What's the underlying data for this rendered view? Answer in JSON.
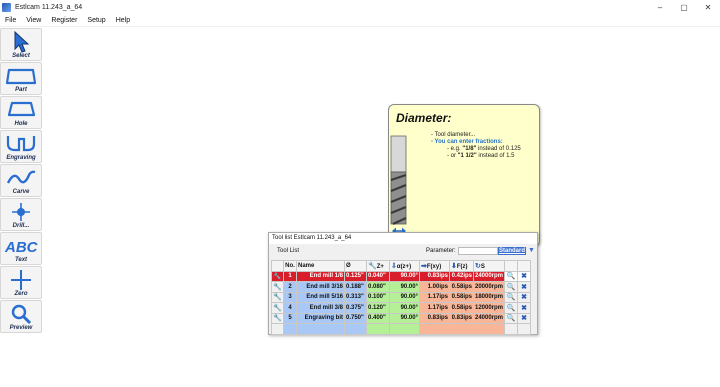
{
  "window": {
    "title": "Estlcam 11.243_a_64",
    "minimize_glyph": "–",
    "maximize_glyph": "▢",
    "close_glyph": "✕"
  },
  "menu": [
    "File",
    "View",
    "Register",
    "Setup",
    "Help"
  ],
  "toolbar": [
    {
      "label": "Select",
      "icon": "cursor-arrow-icon"
    },
    {
      "label": "Part",
      "icon": "part-outline-icon"
    },
    {
      "label": "Hole",
      "icon": "hole-outline-icon"
    },
    {
      "label": "Engraving",
      "icon": "engraving-path-icon"
    },
    {
      "label": "Carve",
      "icon": "carve-wave-icon"
    },
    {
      "label": "Drill...",
      "icon": "drill-target-icon"
    },
    {
      "label": "Text",
      "icon": "text-abc-icon"
    },
    {
      "label": "Zero",
      "icon": "zero-cross-icon"
    },
    {
      "label": "Preview",
      "icon": "magnifier-icon"
    }
  ],
  "tooltip": {
    "title": "Diameter:",
    "line1": "- Tool diameter...",
    "line2": "- You can enter fractions:",
    "line3_prefix": "- e.g. ",
    "line3_bold": "\"1/8\"",
    "line3_suffix": " instead of 0.125",
    "line4_prefix": "- or ",
    "line4_bold": "\"1 1/2\"",
    "line4_suffix": " instead of 1.5"
  },
  "toollist": {
    "window_title": "Tool list Estlcam 11.243_a_64",
    "section_label": "Tool List",
    "parameter_label": "Parameter:",
    "parameter_value": "Standard",
    "columns": [
      "No.",
      "Name",
      "Ø",
      "Z+",
      "α(z+)",
      "F(xy)",
      "F(z)",
      "S"
    ],
    "rows": [
      {
        "no": "1",
        "name": "End mill 1/8",
        "dia": "0.125\"",
        "z": "0.040\"",
        "azf": "90.00°",
        "fxy": "0.83ips",
        "fz": "0.42ips",
        "s": "24000rpm",
        "selected": true
      },
      {
        "no": "2",
        "name": "End mill 3/16",
        "dia": "0.188\"",
        "z": "0.080\"",
        "azf": "90.00°",
        "fxy": "1.00ips",
        "fz": "0.58ips",
        "s": "20000rpm",
        "selected": false
      },
      {
        "no": "3",
        "name": "End mill 5/16",
        "dia": "0.313\"",
        "z": "0.100\"",
        "azf": "90.00°",
        "fxy": "1.17ips",
        "fz": "0.58ips",
        "s": "18000rpm",
        "selected": false
      },
      {
        "no": "4",
        "name": "End mill 3/8",
        "dia": "0.375\"",
        "z": "0.120\"",
        "azf": "90.00°",
        "fxy": "1.17ips",
        "fz": "0.58ips",
        "s": "12000rpm",
        "selected": false
      },
      {
        "no": "5",
        "name": "Engraving bit",
        "dia": "0.750\"",
        "z": "0.400\"",
        "azf": "90.00°",
        "fxy": "0.83ips",
        "fz": "0.83ips",
        "s": "24000rpm",
        "selected": false
      }
    ]
  },
  "colors": {
    "selected_row": "#d81e2b",
    "blue_cells": "#a9c8f5",
    "green_cells": "#b5ef98",
    "orange_cells": "#f8b597",
    "tooltip_bg": "#ffffcc",
    "accent_blue": "#3a6fd0"
  }
}
